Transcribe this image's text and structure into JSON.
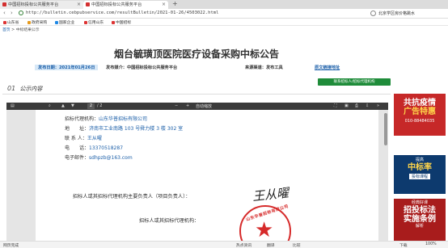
{
  "browser": {
    "tabs": [
      {
        "label": "中国招标投标公共服务平台"
      },
      {
        "label": "中国招标投标公共服务平台"
      }
    ],
    "new_tab_symbol": "+",
    "close_symbol": "×",
    "url": "http://bulletin.cebpubservice.com/resultBulletin/2021-01-26/4503022.html",
    "search_text": "北京学区房价格跳水",
    "back_symbol": "‹",
    "forward_symbol": "›",
    "bookmarks": [
      {
        "label": "山东省",
        "color": "#d33"
      },
      {
        "label": "政府采购",
        "color": "#e69a1c"
      },
      {
        "label": "国家企业",
        "color": "#1e88e5"
      },
      {
        "label": "信用山东",
        "color": "#d33"
      },
      {
        "label": "中国招标",
        "color": "#d33"
      }
    ]
  },
  "breadcrumb": {
    "home": "首页",
    "separator": ">",
    "current": "中标结果公示"
  },
  "notice": {
    "title": "烟台毓璜顶医院医疗设备采购中标公告",
    "publish_date": "发布日期：2021年01月26日",
    "platform": "发布媒介：中国招标投标公共服务平台",
    "source": "来源渠道：发布工具",
    "original_link": "原文链接地址",
    "contact_button": "联系招标人/招标代理机构"
  },
  "section": {
    "number": "01",
    "title": "公示内容"
  },
  "pdf_toolbar": {
    "page_current": "2",
    "page_total": "/ 2",
    "zoom": "自动缩放",
    "minus": "−",
    "plus": "+"
  },
  "pdf_content": {
    "agency_label": "招标代理机构：",
    "agency_value": "山东华普招标有限公司",
    "address_label": "地　　址：",
    "address_value": "济南市工业南路 103 号舜力楼 3 楼 302 室",
    "contact_label": "联 系 人：",
    "contact_value": "王从曜",
    "phone_label": "电　　话：",
    "phone_value": "13370518287",
    "email_label": "电子邮件：",
    "email_value": "sdhpzb@163.com",
    "sign1": "招标人或其招标代理机构主要负责人（项目负责人）：",
    "signature": "王从曜",
    "sign2": "招标人或其招标代理机构：",
    "seal_text": "山东华普招标有限公司"
  },
  "ads": [
    {
      "line1": "共抗疫情",
      "line2": "广告特惠",
      "line3": "010-88484035"
    },
    {
      "line1": "提高",
      "line2": "中标率",
      "line3": "投标课程"
    },
    {
      "line1": "经典好课",
      "line2": "招投标法",
      "line3": "实施条例",
      "line4": "解析"
    }
  ],
  "status_bar": {
    "left": "网页完成",
    "items": [
      "热点资讯",
      "翻译",
      "比较",
      "下载",
      "100%"
    ]
  }
}
